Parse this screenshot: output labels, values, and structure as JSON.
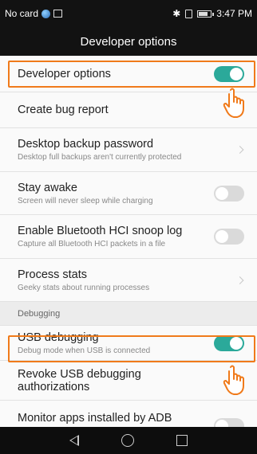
{
  "status_bar": {
    "carrier": "No card",
    "time": "3:47 PM",
    "icons": [
      "globe-icon",
      "image-icon",
      "bluetooth-icon",
      "sim-icon",
      "battery-icon"
    ],
    "battery_level": 0.75
  },
  "app_bar": {
    "title": "Developer options"
  },
  "rows": [
    {
      "title": "Developer options",
      "subtitle": "",
      "control": "toggle",
      "state": "on"
    },
    {
      "title": "Create bug report",
      "subtitle": "",
      "control": "none"
    },
    {
      "title": "Desktop backup password",
      "subtitle": "Desktop full backups aren't currently protected",
      "control": "chevron"
    },
    {
      "title": "Stay awake",
      "subtitle": "Screen will never sleep while charging",
      "control": "toggle",
      "state": "off"
    },
    {
      "title": "Enable Bluetooth HCI snoop log",
      "subtitle": "Capture all Bluetooth HCI packets in a file",
      "control": "toggle",
      "state": "off"
    },
    {
      "title": "Process stats",
      "subtitle": "Geeky stats about running processes",
      "control": "chevron"
    },
    {
      "section": "Debugging"
    },
    {
      "title": "USB debugging",
      "subtitle": "Debug mode when USB is connected",
      "control": "toggle",
      "state": "on"
    },
    {
      "title": "Revoke USB debugging authorizations",
      "subtitle": "",
      "control": "none"
    },
    {
      "title": "Monitor apps installed by ADB",
      "subtitle": "",
      "control": "toggle",
      "state": "off"
    }
  ],
  "colors": {
    "accent": "#2ba99a",
    "highlight": "#f07a1a"
  },
  "nav_bar": {
    "icons": [
      "back-icon",
      "home-icon",
      "recents-icon"
    ]
  }
}
